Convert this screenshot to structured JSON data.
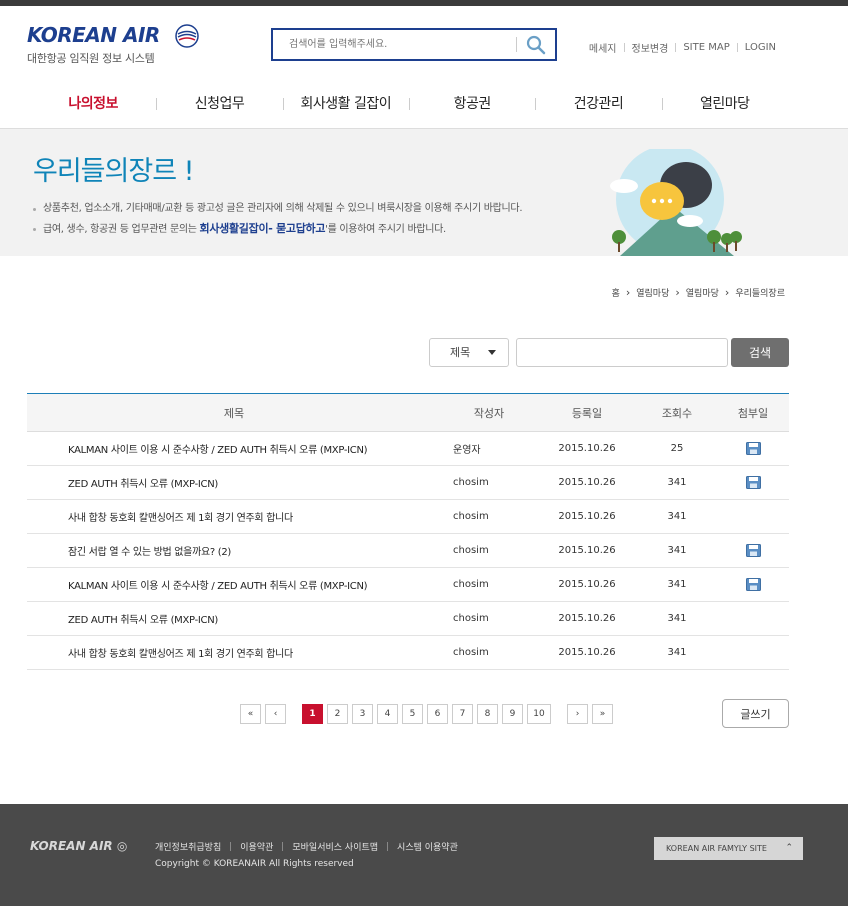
{
  "header": {
    "logo_text": "KOREAN AIR",
    "logo_subtitle": "대한항공 임직원 정보 시스템",
    "search_placeholder": "검색어를 입력해주세요.",
    "util_links": [
      "메세지",
      "정보변경",
      "SITE MAP",
      "LOGIN"
    ]
  },
  "nav": {
    "items": [
      "나의정보",
      "신청업무",
      "회사생활 길잡이",
      "항공권",
      "건강관리",
      "열린마당"
    ],
    "active_index": 0
  },
  "banner": {
    "title": "우리들의장르 !",
    "notes": [
      "상품추천, 업소소개, 기타매매/교환 등 광고성 글은 관리자에 의해 삭제될 수 있으니 벼룩시장을 이용해 주시기 바랍니다."
    ],
    "note2_prefix": "급여, 생수, 항공권 등 업무관련 문의는 ",
    "note2_emphasis": "회사생활길잡이- 묻고답하고",
    "note2_suffix": "'를 이용하여 주시기 바랍니다."
  },
  "breadcrumb": [
    "홈",
    "열림마당",
    "열림마당",
    "우리들의장르"
  ],
  "board_search": {
    "select_value": "제목",
    "input_value": "",
    "button_label": "검색"
  },
  "table": {
    "columns": [
      "제목",
      "작성자",
      "등록일",
      "조회수",
      "첨부일"
    ],
    "rows": [
      {
        "title": "KALMAN 사이트 이용 시 준수사항 /   ZED AUTH 취득시 오류 (MXP-ICN)",
        "writer": "운영자",
        "date": "2015.10.26",
        "views": "25",
        "attach": true
      },
      {
        "title": "ZED AUTH 취득시 오류 (MXP-ICN)",
        "writer": "chosim",
        "date": "2015.10.26",
        "views": "341",
        "attach": true
      },
      {
        "title": "사내 합창 동호회 칼맨싱어즈 제 1회 경기 연주회 합니다",
        "writer": "chosim",
        "date": "2015.10.26",
        "views": "341",
        "attach": false
      },
      {
        "title": "잠긴 서랍 열 수 있는 방법 없을까요? (2)",
        "writer": "chosim",
        "date": "2015.10.26",
        "views": "341",
        "attach": true
      },
      {
        "title": "KALMAN 사이트 이용 시 준수사항 /   ZED AUTH 취득시 오류 (MXP-ICN)",
        "writer": "chosim",
        "date": "2015.10.26",
        "views": "341",
        "attach": true
      },
      {
        "title": "ZED AUTH 취득시 오류 (MXP-ICN)",
        "writer": "chosim",
        "date": "2015.10.26",
        "views": "341",
        "attach": false
      },
      {
        "title": "사내 합창 동호회 칼맨싱어즈 제 1회 경기 연주회 합니다",
        "writer": "chosim",
        "date": "2015.10.26",
        "views": "341",
        "attach": false
      }
    ]
  },
  "pagination": {
    "first": "«",
    "prev": "‹",
    "pages": [
      "1",
      "2",
      "3",
      "4",
      "5",
      "6",
      "7",
      "8",
      "9",
      "10"
    ],
    "current": "1",
    "next": "›",
    "last": "»"
  },
  "write_button": "글쓰기",
  "footer": {
    "logo_text": "KOREAN AIR",
    "links": [
      "개인정보취급방침",
      "이용약관",
      "모바일서비스 사이트맵",
      "시스템 이용약관"
    ],
    "copyright": "Copyright © KOREANAIR  All Rights reserved",
    "family_site": "KOREAN AIR  FAMYLY SITE",
    "family_icon": "chevron-up-icon"
  },
  "colors": {
    "brand_blue": "#1d3f8f",
    "accent_red": "#c8102e",
    "title_blue": "#0f84b8",
    "footer_bg": "#4a4a4a"
  }
}
